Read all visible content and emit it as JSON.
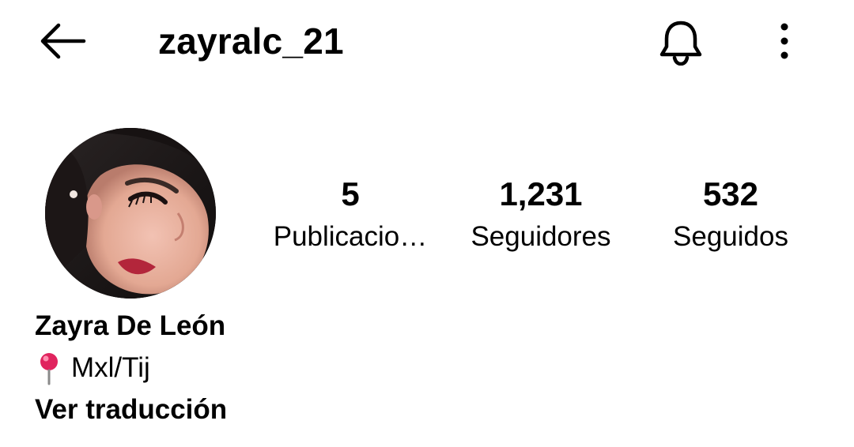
{
  "header": {
    "username": "zayralc_21",
    "back_icon": "arrow-left-icon",
    "notifications_icon": "bell-icon",
    "more_icon": "more-vertical-icon"
  },
  "profile": {
    "avatar_alt": "profile-photo",
    "stats": {
      "posts": {
        "count": "5",
        "label": "Publicacio…"
      },
      "followers": {
        "count": "1,231",
        "label": "Seguidores"
      },
      "following": {
        "count": "532",
        "label": "Seguidos"
      }
    },
    "display_name": "Zayra De León",
    "bio": {
      "location_icon": "map-pin-icon",
      "location": "Mxl/Tij"
    },
    "see_translation": "Ver traducción"
  },
  "colors": {
    "text": "#000000",
    "background": "#ffffff",
    "pin": "#e0245e"
  }
}
